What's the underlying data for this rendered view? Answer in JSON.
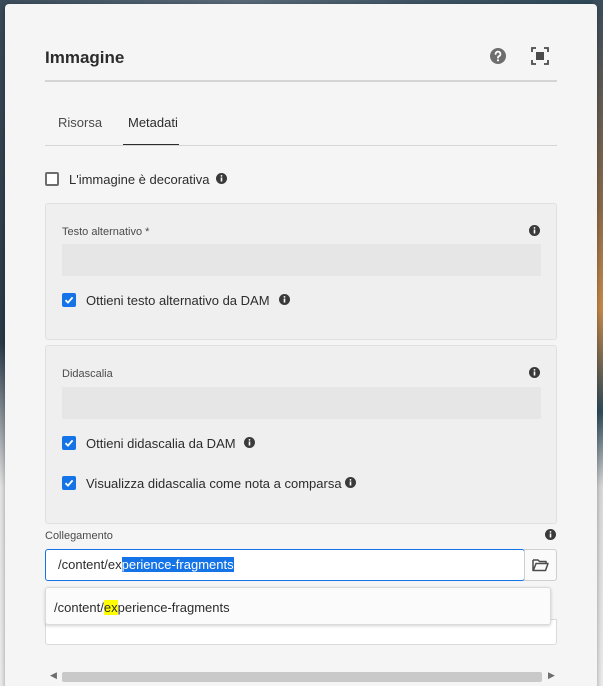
{
  "dialog": {
    "title": "Immagine",
    "help_icon": "help-icon",
    "fullscreen_icon": "fullscreen-icon"
  },
  "tabs": [
    {
      "label": "Risorsa",
      "active": false
    },
    {
      "label": "Metadati",
      "active": true
    }
  ],
  "decorative": {
    "label": "L'immagine è decorativa",
    "checked": false
  },
  "alt_panel": {
    "label": "Testo alternativo *",
    "value": "",
    "dam_checkbox": {
      "label": "Ottieni testo alternativo da DAM",
      "checked": true
    }
  },
  "caption_panel": {
    "label": "Didascalia",
    "value": "",
    "dam_checkbox": {
      "label": "Ottieni didascalia da DAM",
      "checked": true
    },
    "popup_checkbox": {
      "label": "Visualizza didascalia come nota a comparsa",
      "checked": true
    }
  },
  "link": {
    "label": "Collegamento",
    "typed": "/content/ex",
    "autocomplete": "perience-fragments",
    "browse_icon": "folder-icon"
  },
  "suggestion": {
    "prefix": "/content/",
    "match": "ex",
    "suffix": "perience-fragments"
  },
  "colors": {
    "accent": "#1473e6",
    "highlight": "#ffff00",
    "dialog_bg": "#f5f5f5"
  }
}
